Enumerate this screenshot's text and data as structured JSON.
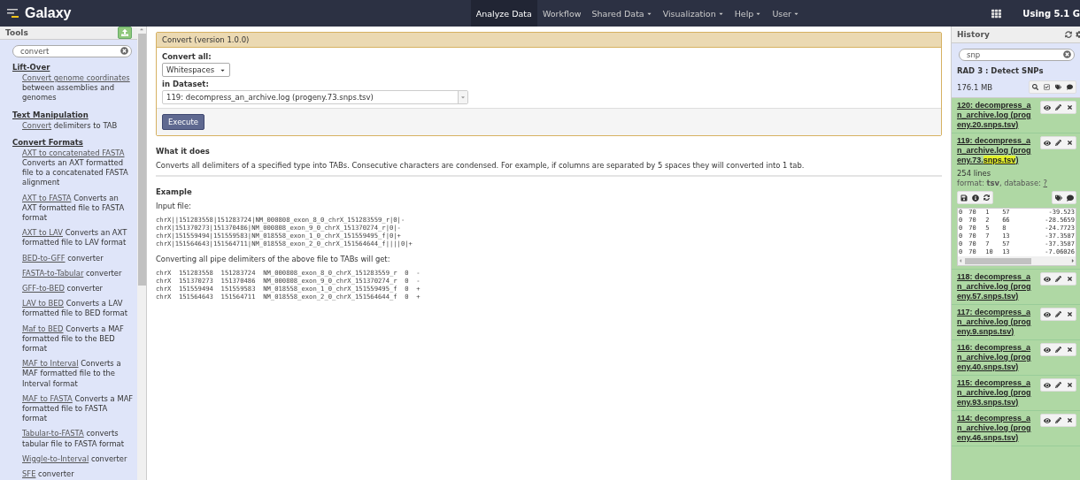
{
  "masthead": {
    "brand": "Galaxy",
    "nav": [
      {
        "label": "Analyze Data",
        "selected": true,
        "dropdown": false
      },
      {
        "label": "Workflow",
        "selected": false,
        "dropdown": false
      },
      {
        "label": "Shared Data",
        "selected": false,
        "dropdown": true
      },
      {
        "label": "Visualization",
        "selected": false,
        "dropdown": true
      },
      {
        "label": "Help",
        "selected": false,
        "dropdown": true
      },
      {
        "label": "User",
        "selected": false,
        "dropdown": true
      }
    ],
    "quota": "Using 5.1 G"
  },
  "tools": {
    "title": "Tools",
    "search": {
      "value": "convert"
    },
    "sections": [
      {
        "title": "Lift-Over",
        "items": [
          {
            "link": "Convert genome coordinates",
            "text": "between assemblies and genomes"
          }
        ]
      },
      {
        "title": "Text Manipulation",
        "items": [
          {
            "link": "Convert",
            "text": "delimiters to TAB"
          }
        ]
      },
      {
        "title": "Convert Formats",
        "items": [
          {
            "link": "AXT to concatenated FASTA",
            "text": "Converts an AXT formatted file to a concatenated FASTA alignment"
          },
          {
            "link": "AXT to FASTA",
            "text": "Converts an AXT formatted file to FASTA format"
          },
          {
            "link": "AXT to LAV",
            "text": "Converts an AXT formatted file to LAV format"
          },
          {
            "link": "BED-to-GFF",
            "text": "converter"
          },
          {
            "link": "FASTA-to-Tabular",
            "text": "converter"
          },
          {
            "link": "GFF-to-BED",
            "text": "converter"
          },
          {
            "link": "LAV to BED",
            "text": "Converts a LAV formatted file to BED format"
          },
          {
            "link": "Maf to BED",
            "text": "Converts a MAF formatted file to the BED format"
          },
          {
            "link": "MAF to Interval",
            "text": "Converts a MAF formatted file to the Interval format"
          },
          {
            "link": "MAF to FASTA",
            "text": "Converts a MAF formatted file to FASTA format"
          },
          {
            "link": "Tabular-to-FASTA",
            "text": "converts tabular file to FASTA format"
          },
          {
            "link": "Wiggle-to-Interval",
            "text": "converter"
          },
          {
            "link": "SFE",
            "text": "converter"
          }
        ]
      }
    ]
  },
  "form": {
    "title": "Convert (version 1.0.0)",
    "fields": [
      {
        "label": "Convert all:",
        "kind": "small",
        "value": "Whitespaces"
      },
      {
        "label": "in Dataset:",
        "kind": "wide",
        "value": "119: decompress_an_archive.log (progeny.73.snps.tsv)"
      }
    ],
    "button": "Execute"
  },
  "help": {
    "what_title": "What it does",
    "what_text": "Converts all delimiters of a specified type into TABs. Consecutive characters are condensed. For example, if columns are separated by 5 spaces they will converted into 1 tab.",
    "example_title": "Example",
    "input_label": "Input file:",
    "input_lines": [
      "chrX||151283558|151283724|NM_000808_exon_8_0_chrX_151283559_r|0|-",
      "chrX|151370273|151370486|NM_000808_exon_9_0_chrX_151370274_r|0|-",
      "chrX|151559494|151559583|NM_018558_exon_1_0_chrX_151559495_f|0|+",
      "chrX|151564643|151564711|NM_018558_exon_2_0_chrX_151564644_f||||0|+"
    ],
    "output_label": "Converting all pipe delimiters of the above file to TABs will get:",
    "output_lines": [
      "chrX  151283558  151283724  NM_000808_exon_8_0_chrX_151283559_r  0  -",
      "chrX  151370273  151370486  NM_000808_exon_9_0_chrX_151370274_r  0  -",
      "chrX  151559494  151559583  NM_018558_exon_1_0_chrX_151559495_f  0  +",
      "chrX  151564643  151564711  NM_018558_exon_2_0_chrX_151564644_f  0  +"
    ]
  },
  "history": {
    "title": "History",
    "search": {
      "value": "snp"
    },
    "name": "RAD 3 : Detect SNPs",
    "size": "176.1 MB",
    "items": [
      {
        "segments": [
          {
            "text": "120: decompress_an_archive.log (progeny.20.snps.tsv)",
            "highlighted": false
          }
        ],
        "expanded": false
      },
      {
        "segments": [
          {
            "text": "119: decompress_an_archive.log (progeny.73.",
            "highlighted": false
          },
          {
            "text": "snps.tsv",
            "highlighted": true
          },
          {
            "text": ")",
            "highlighted": false
          }
        ],
        "expanded": true,
        "lines": "254 lines",
        "format_label": "format:",
        "format": "tsv",
        "database_label": ", database:",
        "database": "?",
        "peek": [
          [
            "0",
            "70",
            "1",
            "57",
            "-39.523"
          ],
          [
            "0",
            "70",
            "2",
            "66",
            "-28.5659"
          ],
          [
            "0",
            "70",
            "5",
            "8",
            "-24.7723"
          ],
          [
            "0",
            "70",
            "7",
            "13",
            "-37.3587"
          ],
          [
            "0",
            "70",
            "7",
            "57",
            "-37.3587"
          ],
          [
            "0",
            "70",
            "10",
            "13",
            "-7.06026"
          ]
        ]
      },
      {
        "segments": [
          {
            "text": "118: decompress_an_archive.log (progeny.57.snps.tsv)",
            "highlighted": false
          }
        ],
        "expanded": false
      },
      {
        "segments": [
          {
            "text": "117: decompress_an_archive.log (progeny.9.snps.tsv)",
            "highlighted": false
          }
        ],
        "expanded": false
      },
      {
        "segments": [
          {
            "text": "116: decompress_an_archive.log (progeny.40.snps.tsv)",
            "highlighted": false
          }
        ],
        "expanded": false
      },
      {
        "segments": [
          {
            "text": "115: decompress_an_archive.log (progeny.93.snps.tsv)",
            "highlighted": false
          }
        ],
        "expanded": false
      },
      {
        "segments": [
          {
            "text": "114: decompress_an_archive.log (progeny.46.snps.tsv)",
            "highlighted": false
          }
        ],
        "expanded": false
      }
    ]
  }
}
